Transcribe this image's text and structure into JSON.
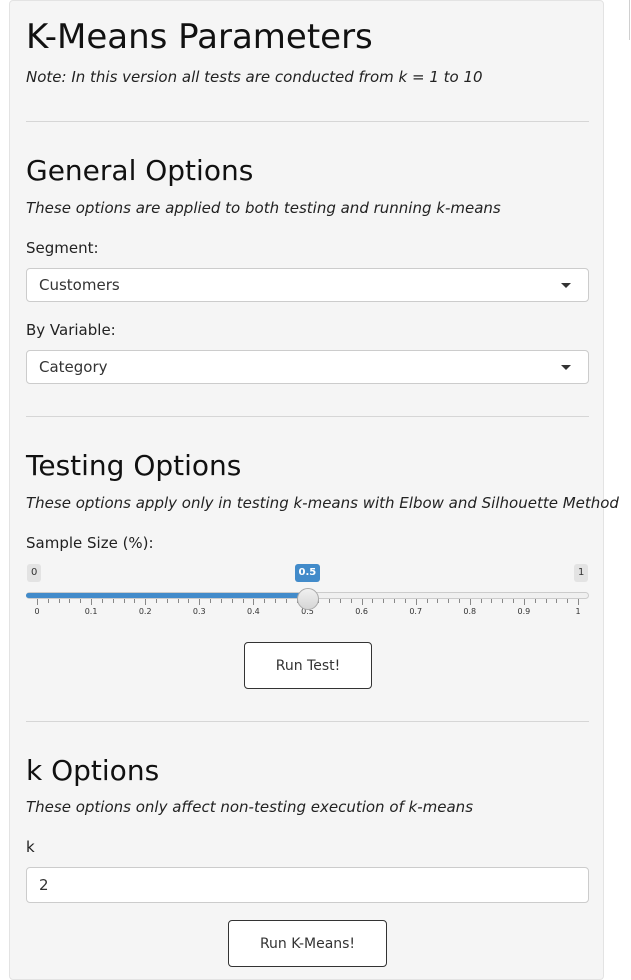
{
  "header": {
    "title": "K-Means Parameters",
    "note": "Note: In this version all tests are conducted from k = 1 to 10"
  },
  "general": {
    "heading": "General Options",
    "note": "These options are applied to both testing and running k-means",
    "segment_label": "Segment:",
    "segment_value": "Customers",
    "byvar_label": "By Variable:",
    "byvar_value": "Category"
  },
  "testing": {
    "heading": "Testing Options",
    "note": "These options apply only in testing k-means with Elbow and Silhouette Method",
    "sample_label": "Sample Size (%):",
    "slider": {
      "min": 0,
      "max": 1,
      "value": 0.5,
      "min_label": "0",
      "max_label": "1",
      "value_label": "0.5",
      "tick_labels": [
        "0",
        "0.1",
        "0.2",
        "0.3",
        "0.4",
        "0.5",
        "0.6",
        "0.7",
        "0.8",
        "0.9",
        "1"
      ],
      "minor_ticks_per_major": 5
    },
    "run_button": "Run Test!"
  },
  "k_options": {
    "heading": "k Options",
    "note": "These options only affect non-testing execution of k-means",
    "k_label": "k",
    "k_value": "2",
    "run_button": "Run K-Means!"
  },
  "colors": {
    "accent": "#428bca",
    "panel_bg": "#f5f5f5"
  },
  "icons": {
    "dropdown": "chevron-down-icon"
  }
}
